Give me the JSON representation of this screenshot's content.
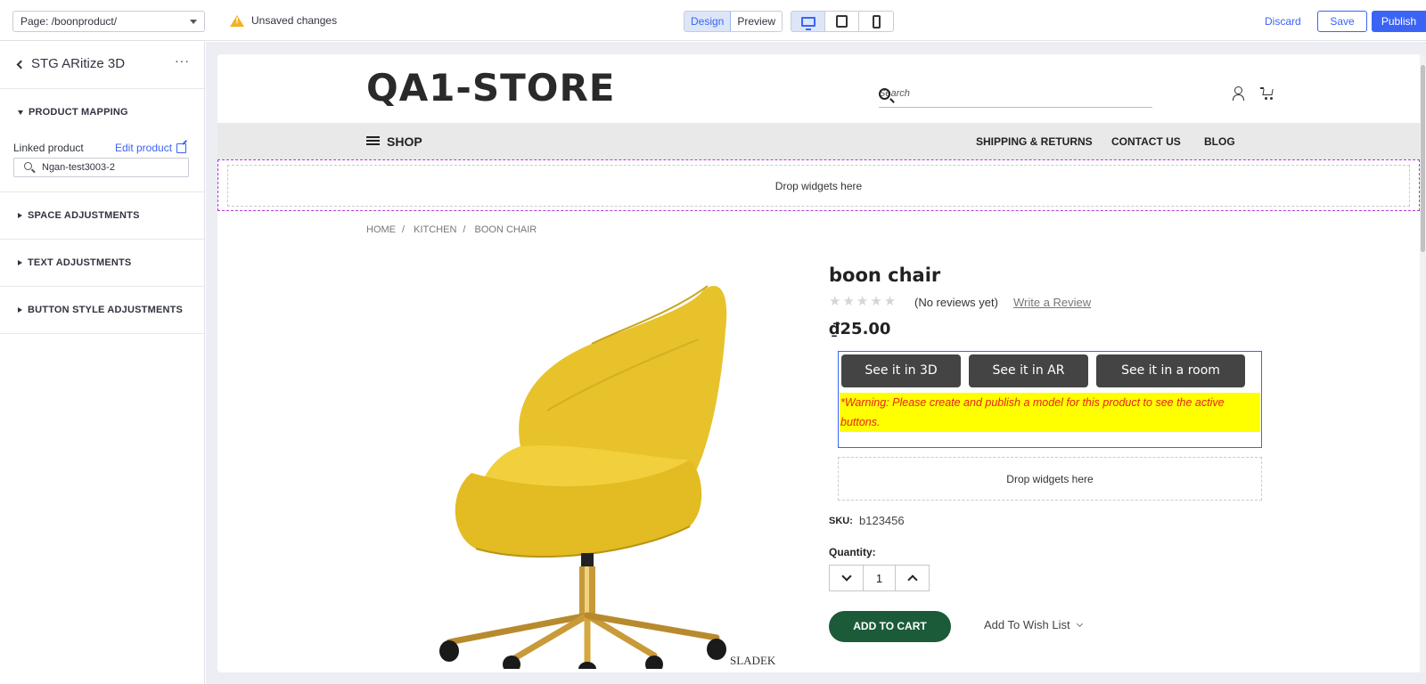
{
  "topbar": {
    "page_select": "Page: /boonproduct/",
    "unsaved": "Unsaved changes",
    "modes": [
      "Design",
      "Preview"
    ],
    "discard": "Discard",
    "save": "Save",
    "publish": "Publish"
  },
  "sidebar": {
    "title": "STG ARitize 3D",
    "more": "···",
    "sections": {
      "product_mapping": "PRODUCT MAPPING",
      "linked_product_label": "Linked product",
      "edit_product": "Edit product",
      "linked_product_value": "Ngan-test3003-2",
      "space": "SPACE ADJUSTMENTS",
      "text": "TEXT ADJUSTMENTS",
      "button_style": "BUTTON STYLE ADJUSTMENTS"
    }
  },
  "store": {
    "logo": "QA1-STORE",
    "search_placeholder": "Search",
    "nav": {
      "shop": "SHOP",
      "shipping": "SHIPPING & RETURNS",
      "contact": "CONTACT US",
      "blog": "BLOG"
    },
    "drop_widgets": "Drop widgets here",
    "breadcrumb": [
      "HOME",
      "KITCHEN",
      "BOON CHAIR"
    ],
    "product": {
      "title": "boon chair",
      "stars": "★★★★★",
      "reviews": "(No reviews yet)",
      "write_review": "Write a Review",
      "price": "₫25.00",
      "ar_buttons": [
        "See it in 3D",
        "See it in AR",
        "See it in a room"
      ],
      "warning": "*Warning: Please create and publish a model for this product to see the active buttons.",
      "sku_label": "SKU:",
      "sku": "b123456",
      "quantity_label": "Quantity:",
      "quantity": "1",
      "add_to_cart": "ADD TO CART",
      "wishlist": "Add To Wish List",
      "image_mark": "SLADEK"
    }
  },
  "colors": {
    "accent": "#3c64f4",
    "chair": "#e8c22b",
    "cart_button": "#1b5b3a",
    "warning_bg": "#ffff00",
    "warning_text": "#e8231d"
  }
}
